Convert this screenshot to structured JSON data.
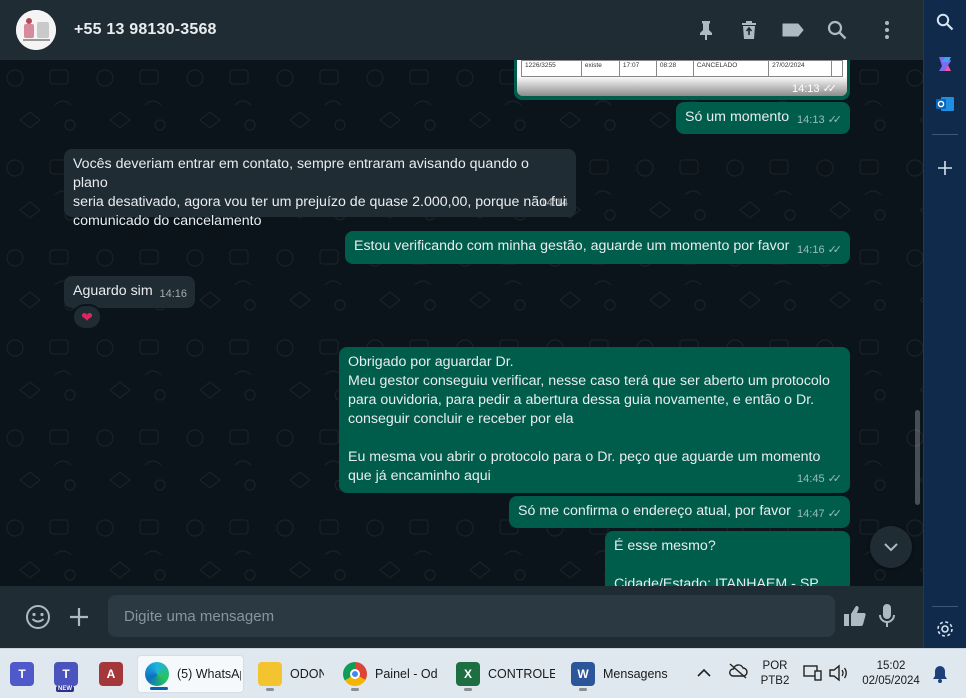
{
  "header": {
    "contact_name": "+55 13 98130-3568",
    "icons": [
      "pin-icon",
      "delete-icon",
      "label-icon",
      "search-icon",
      "menu-icon"
    ]
  },
  "image_message": {
    "cells": [
      "1226/3255",
      "existe",
      "17:07",
      "08:28",
      "CANCELADO",
      "27/02/2024"
    ],
    "time": "14:13"
  },
  "messages": [
    {
      "dir": "out",
      "text": "Só um momento",
      "time": "14:13",
      "status": "read"
    },
    {
      "dir": "in",
      "text": "Vocês deveriam entrar em contato, sempre entraram avisando quando o plano\nseria desativado, agora vou ter um prejuízo de quase 2.000,00, porque não fui\ncomunicado do cancelamento",
      "time": "14:14"
    },
    {
      "dir": "out",
      "text": "Estou verificando com minha gestão, aguarde um momento por favor",
      "time": "14:16",
      "status": "read"
    },
    {
      "dir": "in",
      "text": "Aguardo sim",
      "time": "14:16",
      "reaction": "heart"
    },
    {
      "dir": "out",
      "text": "Obrigado por aguardar Dr.\nMeu gestor conseguiu verificar, nesse caso terá que ser aberto um protocolo\npara ouvidoria, para pedir a abertura dessa guia novamente, e então o Dr.\nconseguir concluir e receber por ela\n\nEu mesma vou abrir o protocolo para o Dr. peço que aguarde um momento\nque já encaminho aqui",
      "time": "14:45",
      "status": "read"
    },
    {
      "dir": "out",
      "text": "Só me confirma o endereço atual, por favor",
      "time": "14:47",
      "status": "read"
    },
    {
      "dir": "out",
      "text": "É esse mesmo?\n\nCidade/Estado: ITANHAEM - SP",
      "time": "",
      "status": ""
    }
  ],
  "compose": {
    "placeholder": "Digite uma mensagem"
  },
  "taskbar": {
    "apps": [
      {
        "name": "teams",
        "label": ""
      },
      {
        "name": "teams-new",
        "label": "",
        "badge": "NEW"
      },
      {
        "name": "access",
        "label": ""
      },
      {
        "name": "edge",
        "label": "(5) WhatsAp",
        "active": true
      },
      {
        "name": "explorer",
        "label": "ODON"
      },
      {
        "name": "chrome",
        "label": "Painel - Odo"
      },
      {
        "name": "excel",
        "label": "CONTROLE"
      },
      {
        "name": "word",
        "label": "Mensagens"
      }
    ],
    "language": "POR",
    "layout": "PTB2",
    "time": "15:02",
    "date": "02/05/2024"
  }
}
